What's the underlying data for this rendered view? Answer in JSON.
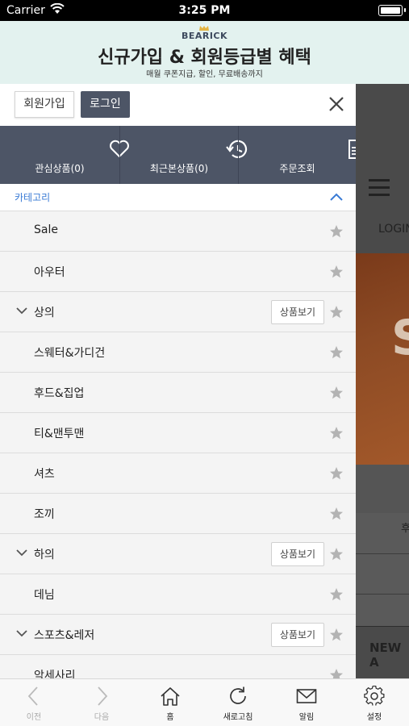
{
  "status_bar": {
    "carrier": "Carrier",
    "time": "3:25 PM"
  },
  "banner": {
    "brand": "BEARICK",
    "title": "신규가입 & 회원등급별 혜택",
    "subtitle": "매월 쿠폰지급, 할인, 무료배송까지"
  },
  "drawer": {
    "join_label": "회원가입",
    "login_label": "로그인",
    "quick_links": [
      {
        "label": "관심상품(0)",
        "icon": "heart-icon"
      },
      {
        "label": "최근본상품(0)",
        "icon": "history-icon"
      },
      {
        "label": "주문조회",
        "icon": "document-icon"
      }
    ],
    "category_header": "카테고리",
    "view_products_label": "상품보기",
    "accent_color": "#3a7bd5",
    "dark_color": "#4d5566",
    "categories": [
      {
        "label": "Sale",
        "expandable": false
      },
      {
        "label": "아우터",
        "expandable": false
      },
      {
        "label": "상의",
        "expandable": true
      },
      {
        "label": "스웨터&가디건",
        "expandable": false
      },
      {
        "label": "후드&집업",
        "expandable": false
      },
      {
        "label": "티&맨투맨",
        "expandable": false
      },
      {
        "label": "셔츠",
        "expandable": false
      },
      {
        "label": "조끼",
        "expandable": false
      },
      {
        "label": "하의",
        "expandable": true
      },
      {
        "label": "데님",
        "expandable": false
      },
      {
        "label": "스포츠&레저",
        "expandable": true
      },
      {
        "label": "악세사리",
        "expandable": false
      }
    ]
  },
  "background_page": {
    "login_text": "LOGIN",
    "hero_letter": "S",
    "partial_text": "후",
    "section_title": "NEW A"
  },
  "tab_bar": [
    {
      "label": "이전",
      "icon": "back-icon",
      "enabled": false
    },
    {
      "label": "다음",
      "icon": "forward-icon",
      "enabled": false
    },
    {
      "label": "홈",
      "icon": "home-icon",
      "enabled": true
    },
    {
      "label": "새로고침",
      "icon": "refresh-icon",
      "enabled": true
    },
    {
      "label": "알림",
      "icon": "mail-icon",
      "enabled": true
    },
    {
      "label": "설정",
      "icon": "settings-icon",
      "enabled": true
    }
  ]
}
